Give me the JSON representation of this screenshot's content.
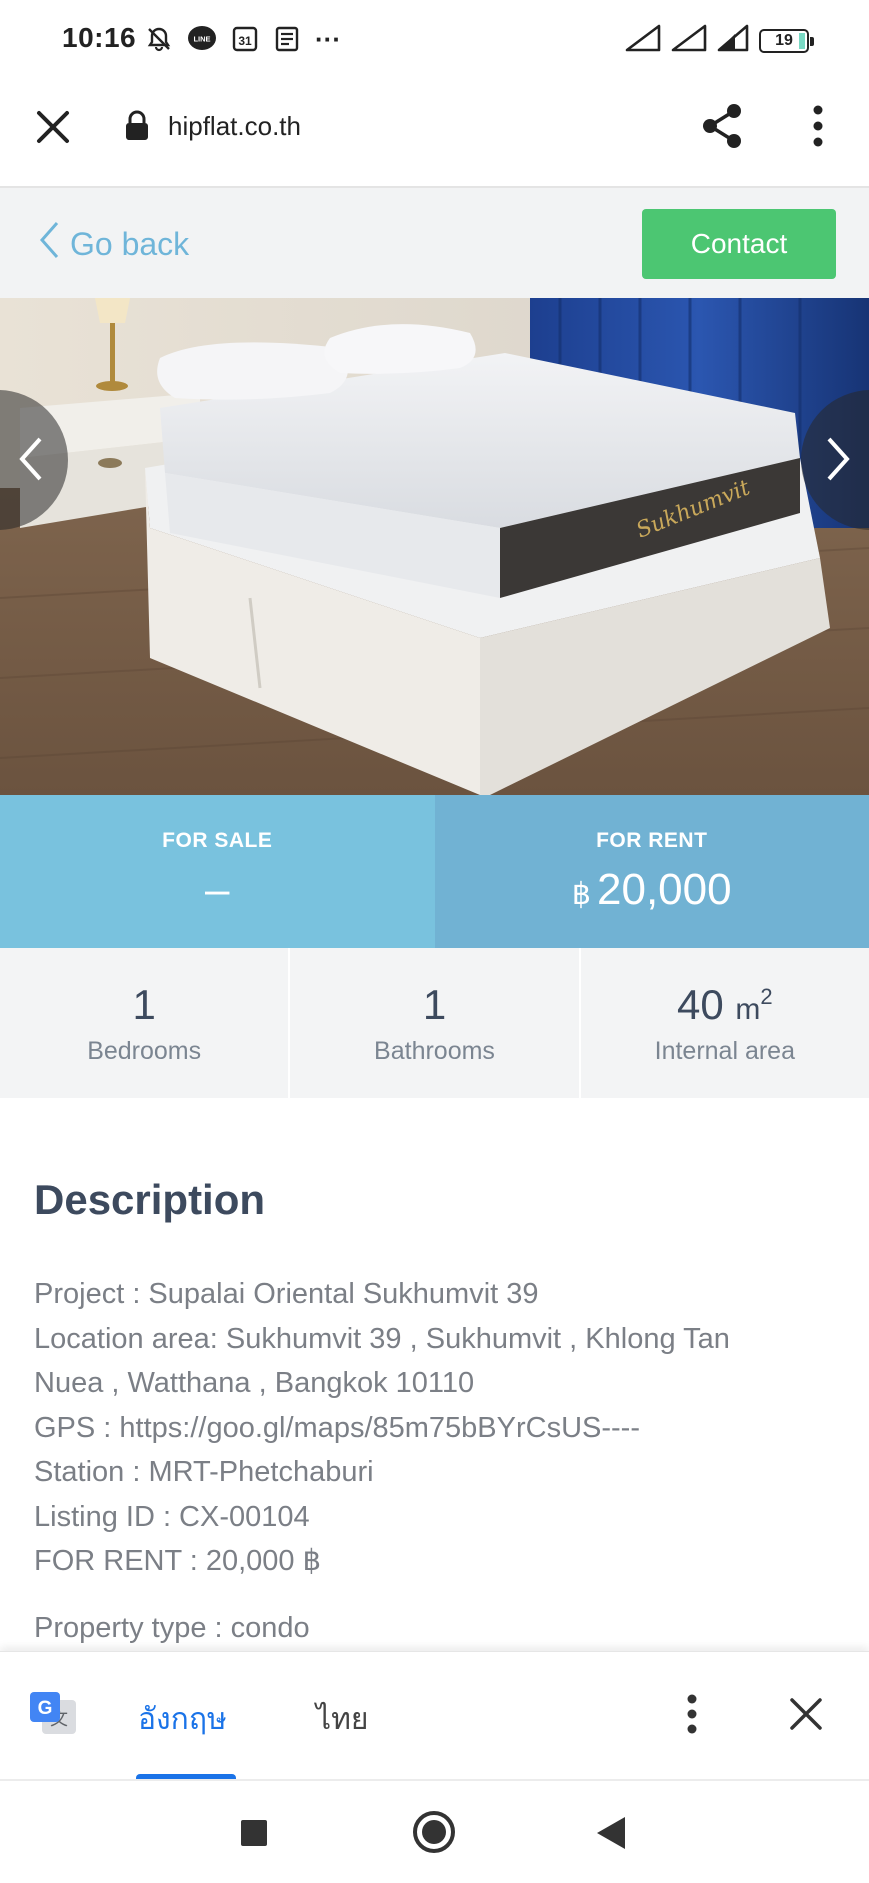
{
  "status_bar": {
    "time": "10:16",
    "calendar_day": "31",
    "line_badge": "LINE",
    "more": "···",
    "battery": "19"
  },
  "browser": {
    "url": "hipflat.co.th"
  },
  "header": {
    "go_back_label": "Go back",
    "contact_label": "Contact"
  },
  "prices": {
    "sale_label": "FOR SALE",
    "sale_value": "–",
    "rent_label": "FOR RENT",
    "rent_currency": "฿",
    "rent_value": "20,000"
  },
  "stats": {
    "bedrooms_value": "1",
    "bedrooms_label": "Bedrooms",
    "bathrooms_value": "1",
    "bathrooms_label": "Bathrooms",
    "area_value": "40",
    "area_unit": "m",
    "area_unit_sup": "2",
    "area_label": "Internal area"
  },
  "description": {
    "title": "Description",
    "lines": [
      "Project : Supalai Oriental Sukhumvit 39",
      "Location area: Sukhumvit 39 , Sukhumvit , Khlong Tan",
      "Nuea , Watthana , Bangkok 10110",
      "GPS : https://goo.gl/maps/85m75bBYrCsUS----",
      "Station : MRT-Phetchaburi",
      "Listing ID : CX-00104",
      "FOR RENT : 20,000 ฿"
    ],
    "property_type": "Property type : condo"
  },
  "translate_bar": {
    "lang_selected": "อังกฤษ",
    "lang_other": "ไทย"
  },
  "colors": {
    "contact_green": "#4cc672",
    "go_back_blue": "#6fb5d9",
    "sale_blue": "#79c2de",
    "rent_blue": "#71b2d3",
    "translate_blue": "#1a73e8"
  }
}
